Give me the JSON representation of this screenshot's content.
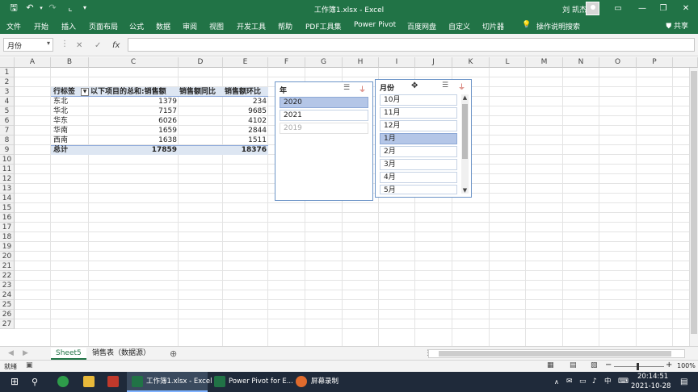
{
  "window": {
    "title": "工作簿1.xlsx  -  Excel",
    "user": "刘 凯杰"
  },
  "ribbon_tabs": [
    "文件",
    "开始",
    "插入",
    "页面布局",
    "公式",
    "数据",
    "审阅",
    "视图",
    "开发工具",
    "帮助",
    "PDF工具集",
    "Power Pivot",
    "百度网盘",
    "自定义",
    "切片器"
  ],
  "tell_me": "操作说明搜索",
  "share": "共享",
  "formula_bar": {
    "name_box": "月份",
    "formula": ""
  },
  "columns": [
    "A",
    "B",
    "C",
    "D",
    "E",
    "F",
    "G",
    "H",
    "I",
    "J",
    "K",
    "L",
    "M",
    "N",
    "O",
    "P"
  ],
  "rows": [
    "1",
    "2",
    "3",
    "4",
    "5",
    "6",
    "7",
    "8",
    "9",
    "10",
    "11",
    "12",
    "13",
    "14",
    "15",
    "16",
    "17",
    "18",
    "19",
    "20",
    "21",
    "22",
    "23",
    "24",
    "25",
    "26",
    "27"
  ],
  "pivot": {
    "headers": [
      "行标签",
      "以下项目的总和:销售额",
      "销售额同比",
      "销售额环比"
    ],
    "rows": [
      [
        "东北",
        "1379",
        "234"
      ],
      [
        "华北",
        "7157",
        "9685"
      ],
      [
        "华东",
        "6026",
        "4102"
      ],
      [
        "华南",
        "1659",
        "2844"
      ],
      [
        "西南",
        "1638",
        "1511"
      ]
    ],
    "total": [
      "总计",
      "17859",
      "18376"
    ]
  },
  "slicer_year": {
    "title": "年",
    "items": [
      {
        "label": "2020",
        "state": "selected"
      },
      {
        "label": "2021",
        "state": "normal"
      },
      {
        "label": "2019",
        "state": "nodata"
      }
    ]
  },
  "slicer_month": {
    "title": "月份",
    "items": [
      {
        "label": "10月",
        "state": "normal"
      },
      {
        "label": "11月",
        "state": "normal"
      },
      {
        "label": "12月",
        "state": "normal"
      },
      {
        "label": "1月",
        "state": "selected"
      },
      {
        "label": "2月",
        "state": "normal"
      },
      {
        "label": "3月",
        "state": "normal"
      },
      {
        "label": "4月",
        "state": "normal"
      },
      {
        "label": "5月",
        "state": "normal"
      }
    ]
  },
  "sheets": [
    "Sheet5",
    "销售表（数据源）"
  ],
  "status": {
    "mode": "就绪",
    "zoom": "100%"
  },
  "taskbar": {
    "apps": [
      "工作簿1.xlsx - Excel",
      "Power Pivot for E...",
      "屏幕录制"
    ],
    "time": "20:14:51",
    "date": "2021-10-28",
    "ime": "中"
  },
  "colors": {
    "excel_green": "#217346",
    "pivot_band": "#dde6f2",
    "slicer_selected": "#b4c6e7",
    "taskbar": "#1f2a3a"
  }
}
